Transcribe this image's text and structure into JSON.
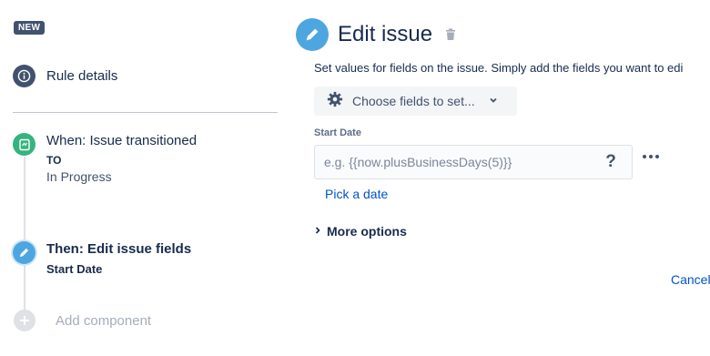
{
  "sidebar": {
    "badge": "NEW",
    "rule_details": "Rule details",
    "trigger": {
      "title": "When: Issue transitioned",
      "to_label": "TO",
      "status": "In Progress"
    },
    "action": {
      "title": "Then: Edit issue fields",
      "field": "Start Date"
    },
    "add_component": "Add component"
  },
  "panel": {
    "title": "Edit issue",
    "description": "Set values for fields on the issue. Simply add the fields you want to edi",
    "choose_fields": "Choose fields to set...",
    "field_label": "Start Date",
    "field_placeholder": "e.g. {{now.plusBusinessDays(5)}}",
    "help": "?",
    "pick_date": "Pick a date",
    "more_options": "More options",
    "cancel": "Cancel"
  },
  "icons": {
    "info": "info-icon",
    "trigger": "trigger-icon",
    "edit": "pencil-icon",
    "add": "plus-icon",
    "trash": "trash-icon",
    "gear": "gear-icon",
    "chevron_down": "chevron-down-icon",
    "chevron_right": "chevron-right-icon",
    "more": "more-dots-icon"
  },
  "colors": {
    "badge_bg": "#42526e",
    "trigger_green": "#36b37e",
    "action_blue": "#4ea6e0",
    "link_blue": "#0052cc",
    "text_dark": "#172b4d"
  }
}
